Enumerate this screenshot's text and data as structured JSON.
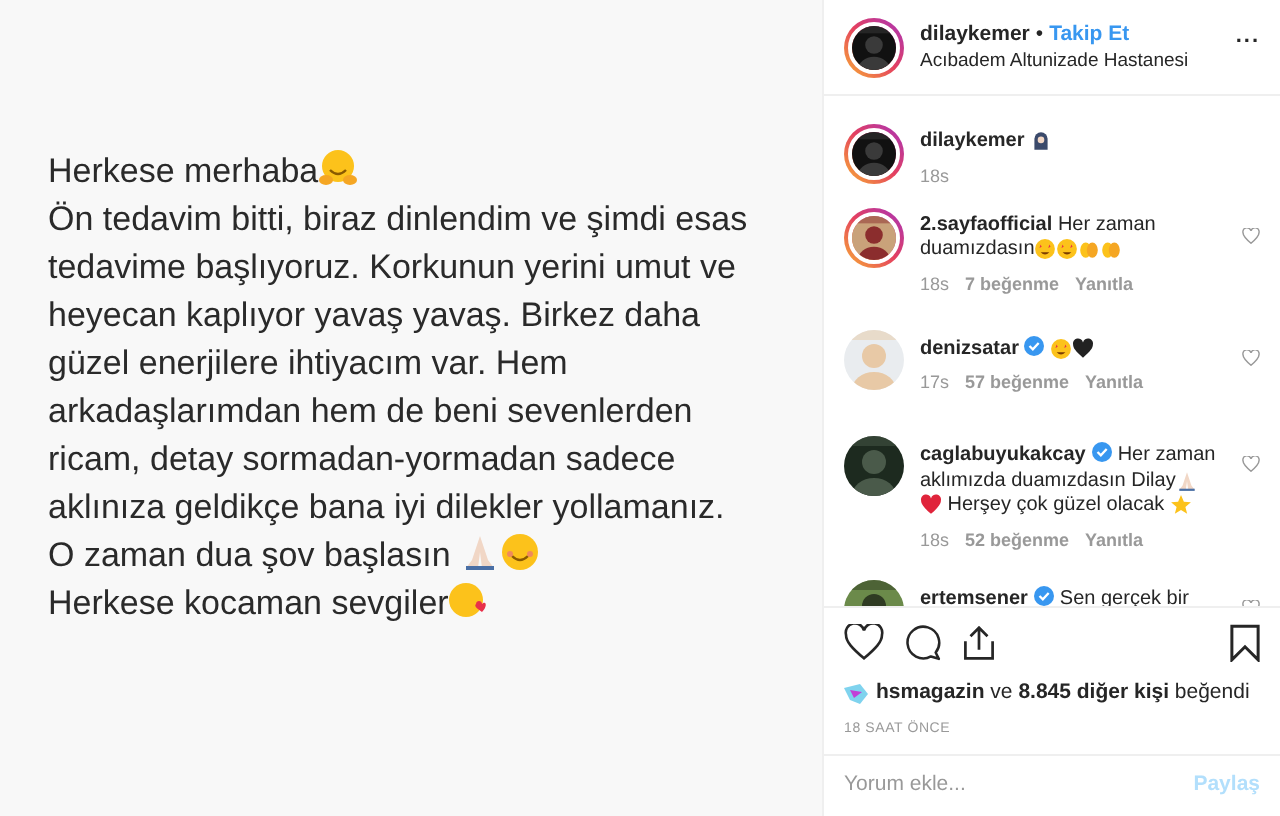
{
  "post_image": {
    "lines": [
      {
        "parts": [
          {
            "kind": "text",
            "text": "Herkese merhaba"
          },
          {
            "kind": "hug"
          }
        ]
      },
      {
        "parts": [
          {
            "kind": "text",
            "text": "Ön tedavim bitti, biraz dinlendim ve şimdi esas"
          }
        ]
      },
      {
        "parts": [
          {
            "kind": "text",
            "text": "tedavime başlıyoruz. Korkunun yerini umut ve"
          }
        ]
      },
      {
        "parts": [
          {
            "kind": "text",
            "text": "heyecan kaplıyor yavaş yavaş. Birkez daha"
          }
        ]
      },
      {
        "parts": [
          {
            "kind": "text",
            "text": "güzel enerjilere ihtiyacım var. Hem"
          }
        ]
      },
      {
        "parts": [
          {
            "kind": "text",
            "text": "arkadaşlarımdan hem de beni sevenlerden"
          }
        ]
      },
      {
        "parts": [
          {
            "kind": "text",
            "text": "ricam, detay sormadan-yormadan sadece"
          }
        ]
      },
      {
        "parts": [
          {
            "kind": "text",
            "text": "aklınıza geldikçe bana iyi dilekler yollamanız."
          }
        ]
      },
      {
        "parts": [
          {
            "kind": "text",
            "text": "O zaman dua şov başlasın "
          },
          {
            "kind": "pray"
          },
          {
            "kind": "smile"
          }
        ]
      },
      {
        "parts": [
          {
            "kind": "text",
            "text": "Herkese kocaman sevgiler"
          },
          {
            "kind": "kiss"
          }
        ]
      }
    ]
  },
  "header": {
    "username": "dilaykemer",
    "separator": "•",
    "follow": "Takip Et",
    "location": "Acıbadem Altunizade Hastanesi",
    "more": "..."
  },
  "comments": [
    {
      "username": "dilaykemer",
      "story_ring": true,
      "verified": false,
      "lines": [
        [
          {
            "kind": "ghost"
          }
        ]
      ],
      "time": "18s"
    },
    {
      "username": "2.sayfaofficial",
      "story_ring": true,
      "verified": false,
      "lines": [
        [
          {
            "kind": "text",
            "text": "Her zaman"
          }
        ],
        [
          {
            "kind": "text",
            "text": "duamızdasın"
          },
          {
            "kind": "starstruck"
          },
          {
            "kind": "starstruck"
          },
          {
            "kind": "clap"
          },
          {
            "kind": "clap"
          }
        ]
      ],
      "time": "18s",
      "likes": "7 beğenme",
      "reply": "Yanıtla"
    },
    {
      "username": "denizsatar",
      "story_ring": false,
      "verified": true,
      "lines": [
        [
          {
            "kind": "starstruck"
          },
          {
            "kind": "blackheart"
          }
        ]
      ],
      "time": "17s",
      "likes": "57 beğenme",
      "reply": "Yanıtla"
    },
    {
      "username": "caglabuyukakcay",
      "story_ring": false,
      "verified": true,
      "lines": [
        [
          {
            "kind": "text",
            "text": "Her zaman"
          }
        ],
        [
          {
            "kind": "text",
            "text": "aklımızda duamızdasın Dilay"
          },
          {
            "kind": "pray"
          }
        ],
        [
          {
            "kind": "redheart"
          },
          {
            "kind": "text",
            "text": " Herşey çok güzel olacak "
          },
          {
            "kind": "star"
          }
        ]
      ],
      "time": "18s",
      "likes": "52 beğenme",
      "reply": "Yanıtla"
    },
    {
      "username": "ertemsener",
      "story_ring": false,
      "verified": true,
      "lines": [
        [
          {
            "kind": "text",
            "text": "Sen gerçek bir"
          }
        ]
      ]
    }
  ],
  "likes": "**hsmagazin** ve **8.845 diğer kişi** beğendi",
  "time_ago": "18 SAAT ÖNCE",
  "add_comment": {
    "placeholder": "Yorum ekle...",
    "button": "Paylaş",
    "disabled": true
  }
}
